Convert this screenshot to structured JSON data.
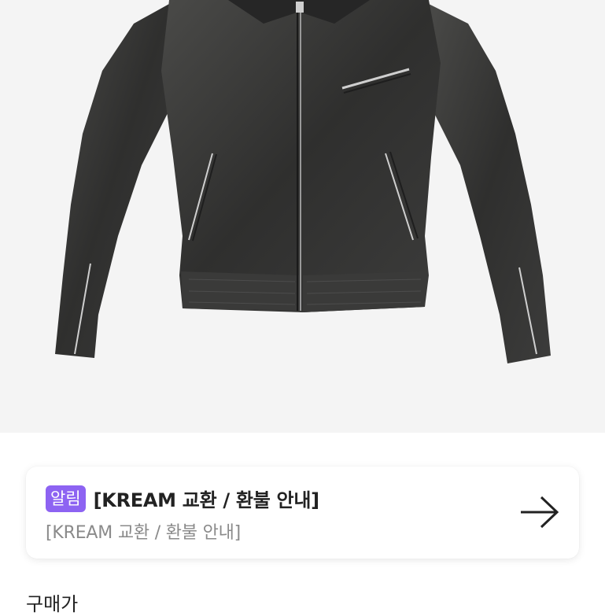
{
  "product": {
    "image_alt": "black leather zip-up jacket"
  },
  "notice": {
    "badge": "알림",
    "title": "[KREAM 교환 / 환불 안내]",
    "subtitle": "[KREAM 교환 / 환불 안내]",
    "arrow_icon": "arrow-right-icon",
    "badge_color": "#8d63f2"
  },
  "section": {
    "heading": "구매가"
  }
}
